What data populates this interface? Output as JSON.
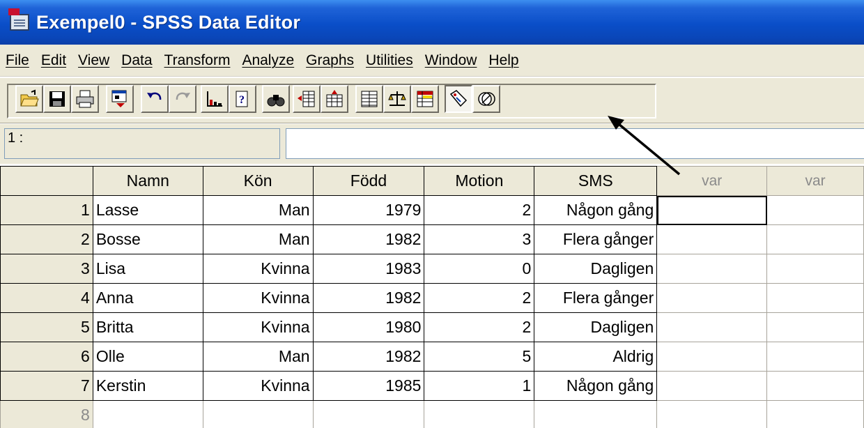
{
  "window": {
    "title": "Exempel0 - SPSS Data Editor",
    "icon": "spss-data-editor-icon"
  },
  "menu": [
    "File",
    "Edit",
    "View",
    "Data",
    "Transform",
    "Analyze",
    "Graphs",
    "Utilities",
    "Window",
    "Help"
  ],
  "toolbar": {
    "buttons": [
      "open-icon",
      "save-icon",
      "print-icon",
      "dialog-recall-icon",
      "undo-icon",
      "redo-icon",
      "goto-chart-icon",
      "goto-case-icon",
      "find-icon",
      "insert-case-icon",
      "insert-variable-icon",
      "split-file-icon",
      "weight-cases-icon",
      "select-cases-icon",
      "value-labels-icon",
      "use-sets-icon"
    ],
    "pressed_button": "value-labels-icon"
  },
  "cell_editor": {
    "reference": "1 :",
    "value": ""
  },
  "grid": {
    "columns": [
      "Namn",
      "Kön",
      "Född",
      "Motion",
      "SMS",
      "var",
      "var"
    ],
    "rows": [
      {
        "n": "1",
        "namn": "Lasse",
        "kon": "Man",
        "fodd": "1979",
        "motion": "2",
        "sms": "Någon gång"
      },
      {
        "n": "2",
        "namn": "Bosse",
        "kon": "Man",
        "fodd": "1982",
        "motion": "3",
        "sms": "Flera gånger"
      },
      {
        "n": "3",
        "namn": "Lisa",
        "kon": "Kvinna",
        "fodd": "1983",
        "motion": "0",
        "sms": "Dagligen"
      },
      {
        "n": "4",
        "namn": "Anna",
        "kon": "Kvinna",
        "fodd": "1982",
        "motion": "2",
        "sms": "Flera gånger"
      },
      {
        "n": "5",
        "namn": "Britta",
        "kon": "Kvinna",
        "fodd": "1980",
        "motion": "2",
        "sms": "Dagligen"
      },
      {
        "n": "6",
        "namn": "Olle",
        "kon": "Man",
        "fodd": "1982",
        "motion": "5",
        "sms": "Aldrig"
      },
      {
        "n": "7",
        "namn": "Kerstin",
        "kon": "Kvinna",
        "fodd": "1985",
        "motion": "1",
        "sms": "Någon gång"
      }
    ],
    "empty_row": "8"
  },
  "colors": {
    "titlebar": "#0a4ec8",
    "chrome": "#ece9d8",
    "arrow": "#000000"
  }
}
